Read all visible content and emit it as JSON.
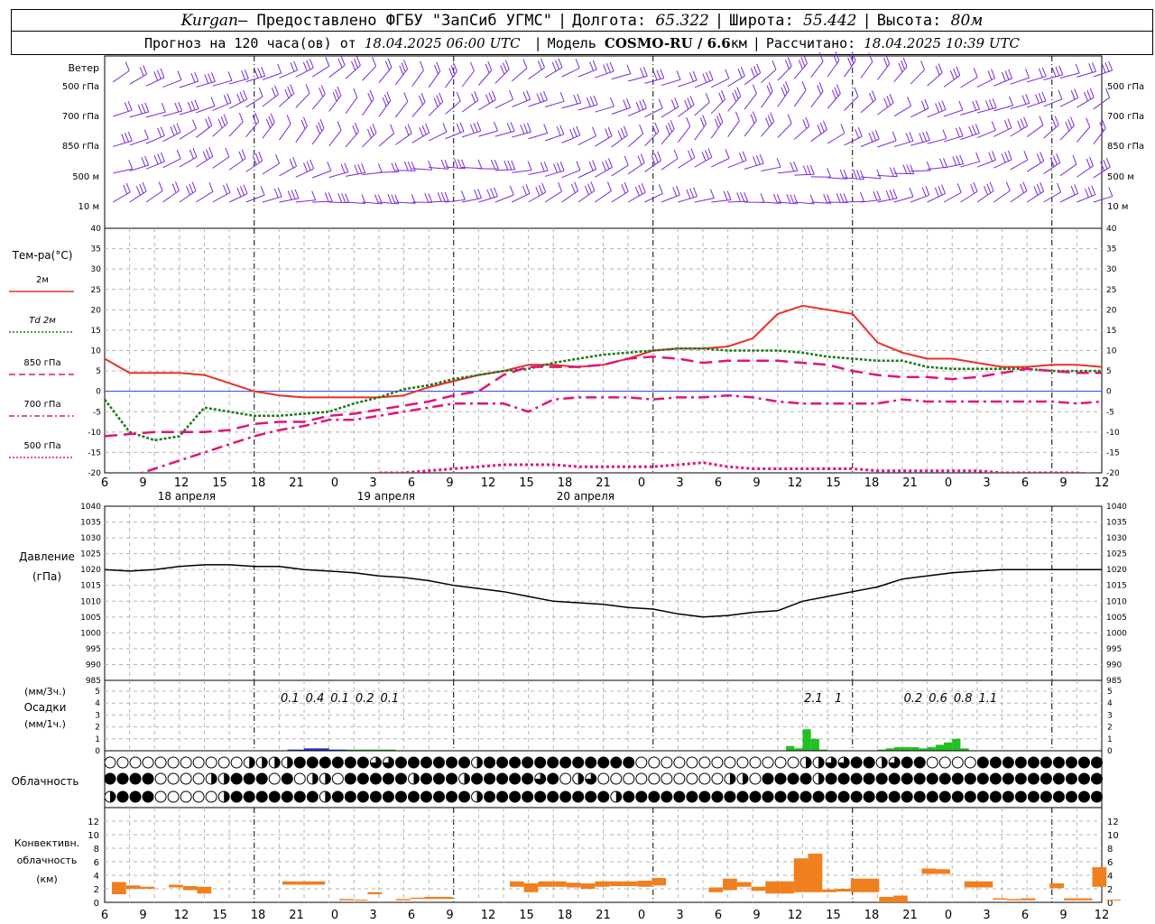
{
  "header": {
    "station": "Kurgan",
    "provider": " — Предоставлено ФГБУ \"ЗапСиб УГМС\"",
    "lon_label": "Долгота:",
    "lon": "65.322",
    "lat_label": "Широта:",
    "lat": "55.442",
    "alt_label": "Высота:",
    "alt": "80м",
    "forecast_prefix": "Прогноз на 120 часа(ов) от",
    "run_time": "18.04.2025 06:00 UTC",
    "model_label": "Модель",
    "model": "COSMO-RU / 6.6",
    "model_unit": "км",
    "calc_label": "Рассчитано:",
    "calc_time": "18.04.2025 10:39 UTC"
  },
  "colors": {
    "t2m": "#e8302a",
    "td2m": "#1a7a1a",
    "t850": "#e0147a",
    "t700": "#e0147a",
    "t500": "#e0147a",
    "wind": "#7a2ad8",
    "pressure": "#000000",
    "precip_snow": "#2030d0",
    "precip_rain": "#22c022",
    "convective": "#f07f1e",
    "zero_line": "#3040ff",
    "grid": "#b4b4b4"
  },
  "time_axis": {
    "hour_labels": [
      "6",
      "9",
      "12",
      "15",
      "18",
      "21",
      "0",
      "3",
      "6",
      "9",
      "12",
      "15",
      "18",
      "21",
      "0",
      "3",
      "6",
      "9",
      "12",
      "15",
      "18",
      "21",
      "0",
      "3",
      "6",
      "9",
      "12"
    ],
    "day_labels": [
      "18 апреля",
      "19 апреля",
      "20 апреля"
    ]
  },
  "wind_panel": {
    "title": "Ветер",
    "levels": [
      "500 гПа",
      "700 гПа",
      "850 гПа",
      "500 м",
      "10 м"
    ],
    "levels_right": [
      "500 гПа",
      "700 гПа",
      "850 гПа",
      "500 м",
      "10 м"
    ]
  },
  "chart_data": [
    {
      "type": "line",
      "title": "Тем-ра(°С)",
      "ylim": [
        -20,
        40
      ],
      "yticks": [
        40,
        35,
        30,
        25,
        20,
        15,
        10,
        5,
        0,
        -5,
        -10,
        -15,
        -20
      ],
      "x_hours_from_start": [
        0,
        3,
        6,
        9,
        12,
        15,
        18,
        21,
        24,
        27,
        30,
        33,
        36,
        39,
        42,
        45,
        48,
        51,
        54,
        57,
        60,
        63,
        66,
        69,
        72,
        75,
        78,
        81,
        84,
        87,
        90,
        93,
        96,
        99,
        102,
        105,
        108,
        111,
        114,
        117,
        120
      ],
      "series": [
        {
          "name": "2м",
          "values": [
            8,
            4.5,
            4.5,
            4.5,
            4,
            2,
            0,
            -1,
            -1.5,
            -1.5,
            -1.5,
            -1.5,
            -1,
            1,
            2.5,
            4,
            5,
            6.5,
            6.5,
            6,
            6.5,
            8,
            10,
            10.5,
            10.5,
            11,
            13,
            19,
            21,
            20,
            19,
            12,
            9.5,
            8,
            8,
            7,
            6,
            6,
            6.5,
            6.5,
            6
          ]
        },
        {
          "name": "Td 2м",
          "values": [
            -2,
            -10,
            -12,
            -11,
            -4,
            -5,
            -6,
            -6,
            -5.5,
            -5,
            -3,
            -1.5,
            0.5,
            1.5,
            3,
            4,
            5,
            5.5,
            7,
            8,
            9,
            9.5,
            10,
            10.5,
            10.5,
            10,
            10,
            10,
            9.5,
            8.5,
            8,
            7.5,
            7.5,
            6,
            5.5,
            5.5,
            5.5,
            5.5,
            5,
            5,
            5
          ]
        },
        {
          "name": "850 гПа",
          "values": [
            -11,
            -10.5,
            -10,
            -10,
            -10,
            -9.5,
            -8,
            -7.5,
            -7.5,
            -6,
            -5.5,
            -4.5,
            -3.5,
            -2.5,
            -1,
            0,
            4,
            6,
            6,
            6,
            6.5,
            8,
            8.5,
            8,
            7,
            7.5,
            7.5,
            7.5,
            7,
            6.5,
            5,
            4,
            3.5,
            3.5,
            3,
            3.5,
            4.5,
            5.5,
            5,
            4.5,
            4.5
          ]
        },
        {
          "name": "700 гПа",
          "values": [
            -23,
            -21,
            -19,
            -17,
            -15,
            -13,
            -11,
            -9.5,
            -8.5,
            -7,
            -7,
            -6,
            -5,
            -4,
            -3,
            -3,
            -3,
            -5,
            -2,
            -1.5,
            -1.5,
            -1.5,
            -2,
            -1.5,
            -1.5,
            -1,
            -1.5,
            -2.5,
            -3,
            -3,
            -3,
            -3,
            -2,
            -2.5,
            -2.5,
            -2.5,
            -2.5,
            -2.5,
            -2.5,
            -3,
            -2.5
          ]
        },
        {
          "name": "500 гПа",
          "values": [
            -25,
            -24,
            -23,
            -22,
            -22,
            -22,
            -22,
            -22,
            -22,
            -21.5,
            -21,
            -20,
            -20,
            -19.5,
            -19,
            -18.5,
            -18,
            -18,
            -18,
            -18.5,
            -18.5,
            -18.5,
            -18.5,
            -18,
            -17.5,
            -18.5,
            -19,
            -19,
            -19,
            -19,
            -19,
            -19.5,
            -19.5,
            -19.5,
            -19.5,
            -19.5,
            -20,
            -20,
            -20,
            -20,
            -20.5
          ]
        }
      ]
    },
    {
      "type": "line",
      "title": "Давление",
      "unit": "(гПа)",
      "ylim": [
        985,
        1040
      ],
      "yticks": [
        1040,
        1035,
        1030,
        1025,
        1020,
        1015,
        1010,
        1005,
        1000,
        995,
        990,
        985
      ],
      "x_hours_from_start": [
        0,
        3,
        6,
        9,
        12,
        15,
        18,
        21,
        24,
        27,
        30,
        33,
        36,
        39,
        42,
        45,
        48,
        51,
        54,
        57,
        60,
        63,
        66,
        69,
        72,
        75,
        78,
        81,
        84,
        87,
        90,
        93,
        96,
        99,
        102,
        105,
        108,
        111,
        114,
        117,
        120
      ],
      "series": [
        {
          "name": "Давление",
          "values": [
            1020,
            1019.5,
            1020,
            1021,
            1021.5,
            1021.5,
            1021,
            1021,
            1020,
            1019.5,
            1019,
            1018,
            1017.5,
            1016.5,
            1015,
            1014,
            1013,
            1011.5,
            1010,
            1009.5,
            1009,
            1008,
            1007.5,
            1006,
            1005,
            1005.5,
            1006.5,
            1007,
            1010,
            1011.5,
            1013,
            1014.5,
            1017,
            1018,
            1019,
            1019.5,
            1020,
            1020,
            1020,
            1020,
            1020
          ]
        }
      ]
    },
    {
      "type": "bar",
      "title": "Осадки",
      "unit_top": "(мм/3ч.)",
      "unit_bottom": "(мм/1ч.)",
      "ylim": [
        0,
        5
      ],
      "yticks": [
        "5",
        "4",
        "3",
        "2",
        "1",
        "0"
      ],
      "yticks_right": [
        "5",
        "4",
        "3",
        "2",
        "1",
        "0"
      ],
      "totals_3h": [
        {
          "hour": 21,
          "value": "0.1"
        },
        {
          "hour": 24,
          "value": "0.4"
        },
        {
          "hour": 27,
          "value": "0.1"
        },
        {
          "hour": 30,
          "value": "0.2"
        },
        {
          "hour": 33,
          "value": "0.1"
        },
        {
          "hour": 84,
          "value": "2.1"
        },
        {
          "hour": 87,
          "value": "1"
        },
        {
          "hour": 96,
          "value": "0.2"
        },
        {
          "hour": 99,
          "value": "0.6"
        },
        {
          "hour": 102,
          "value": "0.8"
        },
        {
          "hour": 105,
          "value": "1.1"
        }
      ],
      "hourly_snow": [
        [
          22,
          0.1
        ],
        [
          23,
          0.1
        ],
        [
          24,
          0.2
        ],
        [
          25,
          0.2
        ],
        [
          26,
          0.2
        ],
        [
          27,
          0.1
        ],
        [
          28,
          0.1
        ]
      ],
      "hourly_rain": [
        [
          29,
          0.1
        ],
        [
          30,
          0.1
        ],
        [
          31,
          0.1
        ],
        [
          32,
          0.1
        ],
        [
          33,
          0.1
        ],
        [
          34,
          0.1
        ],
        [
          82,
          0.4
        ],
        [
          83,
          0.2
        ],
        [
          84,
          1.8
        ],
        [
          85,
          1
        ],
        [
          86,
          0.1
        ],
        [
          93,
          0.1
        ],
        [
          94,
          0.2
        ],
        [
          95,
          0.3
        ],
        [
          96,
          0.3
        ],
        [
          97,
          0.3
        ],
        [
          98,
          0.2
        ],
        [
          99,
          0.3
        ],
        [
          100,
          0.5
        ],
        [
          101,
          0.7
        ],
        [
          102,
          1
        ],
        [
          103,
          0.2
        ]
      ]
    },
    {
      "type": "bar",
      "title": "Конвективн. облачность",
      "unit": "(км)",
      "ylim": [
        0,
        14
      ],
      "yticks": [
        "12",
        "10",
        "8",
        "6",
        "4",
        "2",
        "0"
      ],
      "bars_km": [
        {
          "h": 0,
          "lo": 1.2,
          "hi": 3
        },
        {
          "h": 1,
          "lo": 2,
          "hi": 2.5
        },
        {
          "h": 2,
          "lo": 2,
          "hi": 2.3
        },
        {
          "h": 4,
          "lo": 2.2,
          "hi": 2.6
        },
        {
          "h": 5,
          "lo": 1.8,
          "hi": 2.4
        },
        {
          "h": 6,
          "lo": 1.3,
          "hi": 2.3
        },
        {
          "h": 12,
          "lo": 2.6,
          "hi": 3.1
        },
        {
          "h": 13,
          "lo": 2.6,
          "hi": 3.1
        },
        {
          "h": 14,
          "lo": 2.6,
          "hi": 3.1
        },
        {
          "h": 16,
          "lo": 0.3,
          "hi": 0.5
        },
        {
          "h": 17,
          "lo": 0.3,
          "hi": 0.4
        },
        {
          "h": 18,
          "lo": 1.2,
          "hi": 1.5
        },
        {
          "h": 20,
          "lo": 0.3,
          "hi": 0.5
        },
        {
          "h": 21,
          "lo": 0.5,
          "hi": 0.7
        },
        {
          "h": 22,
          "lo": 0.5,
          "hi": 0.8
        },
        {
          "h": 23,
          "lo": 0.5,
          "hi": 0.8
        },
        {
          "h": 28,
          "lo": 2.3,
          "hi": 3.1
        },
        {
          "h": 29,
          "lo": 1.5,
          "hi": 2.8
        },
        {
          "h": 30,
          "lo": 2.3,
          "hi": 3.1
        },
        {
          "h": 31,
          "lo": 2.3,
          "hi": 3.1
        },
        {
          "h": 32,
          "lo": 2.2,
          "hi": 2.9
        },
        {
          "h": 33,
          "lo": 2,
          "hi": 2.8
        },
        {
          "h": 34,
          "lo": 2.3,
          "hi": 3.1
        },
        {
          "h": 35,
          "lo": 2.4,
          "hi": 3.1
        },
        {
          "h": 36,
          "lo": 2.4,
          "hi": 3.1
        },
        {
          "h": 37,
          "lo": 2.3,
          "hi": 3.2
        },
        {
          "h": 38,
          "lo": 2.5,
          "hi": 3.6
        },
        {
          "h": 42,
          "lo": 1.5,
          "hi": 2.2
        },
        {
          "h": 43,
          "lo": 1.8,
          "hi": 3.5
        },
        {
          "h": 44,
          "lo": 2.3,
          "hi": 3
        },
        {
          "h": 45,
          "lo": 1.7,
          "hi": 2.3
        },
        {
          "h": 46,
          "lo": 1.3,
          "hi": 3.1
        },
        {
          "h": 47,
          "lo": 1.3,
          "hi": 3.1
        },
        {
          "h": 48,
          "lo": 1.5,
          "hi": 6.5
        },
        {
          "h": 49,
          "lo": 1.5,
          "hi": 7.2
        },
        {
          "h": 50,
          "lo": 1.5,
          "hi": 1.9
        },
        {
          "h": 51,
          "lo": 1.6,
          "hi": 2
        },
        {
          "h": 52,
          "lo": 1.5,
          "hi": 3.5
        },
        {
          "h": 53,
          "lo": 1.5,
          "hi": 3.5
        },
        {
          "h": 54,
          "lo": 0,
          "hi": 0.8
        },
        {
          "h": 55,
          "lo": 0,
          "hi": 1
        },
        {
          "h": 57,
          "lo": 4.2,
          "hi": 5
        },
        {
          "h": 58,
          "lo": 4.2,
          "hi": 4.9
        },
        {
          "h": 60,
          "lo": 2.2,
          "hi": 3.1
        },
        {
          "h": 61,
          "lo": 2.2,
          "hi": 3.1
        },
        {
          "h": 62,
          "lo": 0.4,
          "hi": 0.6
        },
        {
          "h": 63,
          "lo": 0.3,
          "hi": 0.5
        },
        {
          "h": 64,
          "lo": 0.3,
          "hi": 0.6
        },
        {
          "h": 66,
          "lo": 2.1,
          "hi": 2.8
        },
        {
          "h": 67,
          "lo": 0.3,
          "hi": 0.6
        },
        {
          "h": 68,
          "lo": 0.3,
          "hi": 0.6
        },
        {
          "h": 69,
          "lo": 2.3,
          "hi": 5.2
        },
        {
          "h": 70,
          "lo": 0.3,
          "hi": 0.4
        }
      ]
    }
  ],
  "cloud_panel": {
    "title": "Облачность",
    "rows": [
      "00000000000CCCCFFFFFFHHFFFFFFCFFFFFFFFFFFF0000000000000CCHHFFCHFF0000FFFFFFF",
      "FFFF0000CCFFF0F0CC0FFFFFCFFFCFFFFFHF0CH0000000000CC0FFFFCFFFFFFFFFFFFFFFFFF",
      "CFFF00000CFFFFFFFCFFFFFFFFFFFCFFFFFFFFFFCFFFFFFFFFFFFFFFFFFFFFFFFFFFFFFFFFFFFF"
    ]
  }
}
